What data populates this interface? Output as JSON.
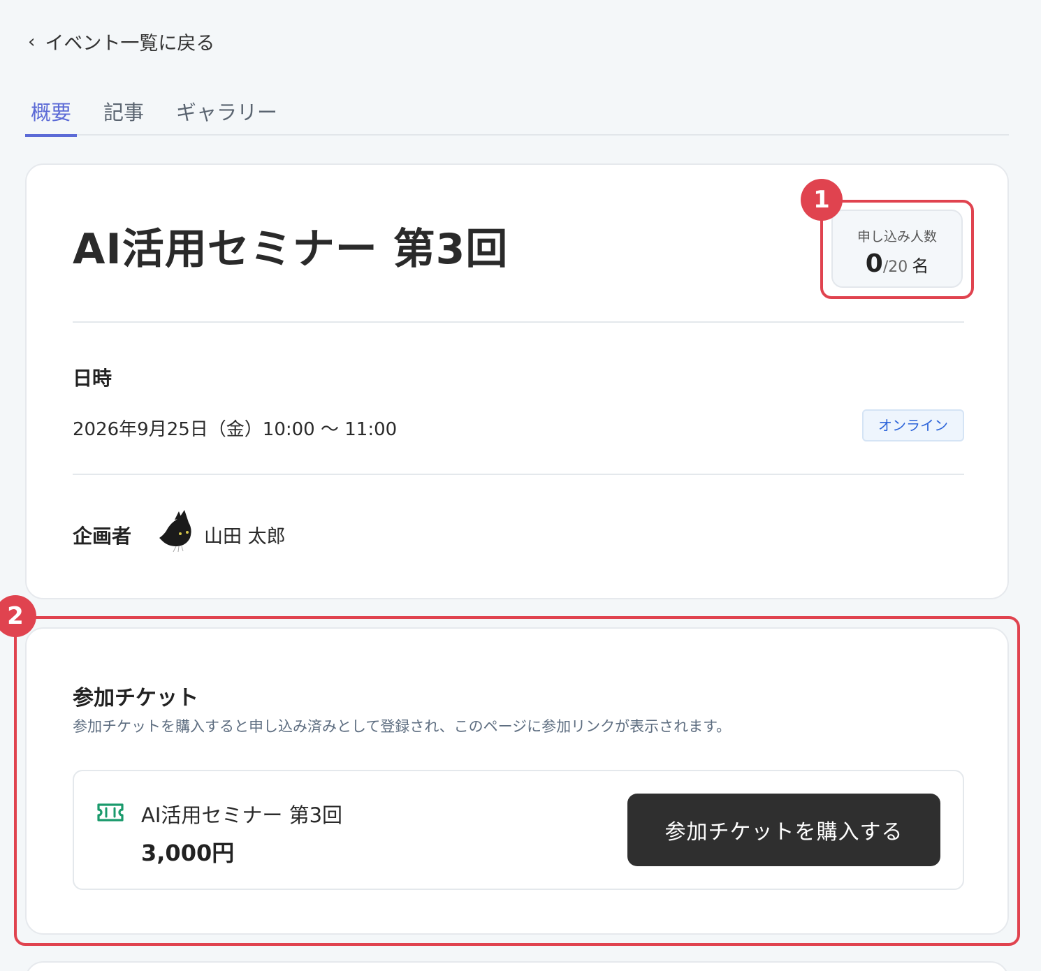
{
  "nav": {
    "back_label": "イベント一覧に戻る"
  },
  "tabs": [
    {
      "label": "概要",
      "active": true
    },
    {
      "label": "記事",
      "active": false
    },
    {
      "label": "ギャラリー",
      "active": false
    }
  ],
  "event": {
    "title": "AI活用セミナー 第3回",
    "capacity": {
      "label": "申し込み人数",
      "current": "0",
      "max": "/20",
      "unit": "名"
    },
    "datetime": {
      "label": "日時",
      "value": "2026年9月25日（金）10:00 〜 11:00",
      "badge": "オンライン"
    },
    "organizer": {
      "label": "企画者",
      "name": "山田 太郎",
      "avatar_icon": "black-cat-avatar-icon"
    }
  },
  "ticket": {
    "heading": "参加チケット",
    "description": "参加チケットを購入すると申し込み済みとして登録され、このページに参加リンクが表示されます。",
    "item": {
      "icon": "ticket-icon",
      "name": "AI活用セミナー 第3回",
      "price": "3,000円",
      "buy_label": "参加チケットを購入する"
    }
  },
  "annotations": [
    {
      "label": "1"
    },
    {
      "label": "2"
    }
  ],
  "colors": {
    "accent": "#5b6ad6",
    "annotation": "#e0434f",
    "button_bg": "#2f2f2f",
    "badge_text": "#2b63d9",
    "ticket_icon": "#1a9a6c"
  }
}
